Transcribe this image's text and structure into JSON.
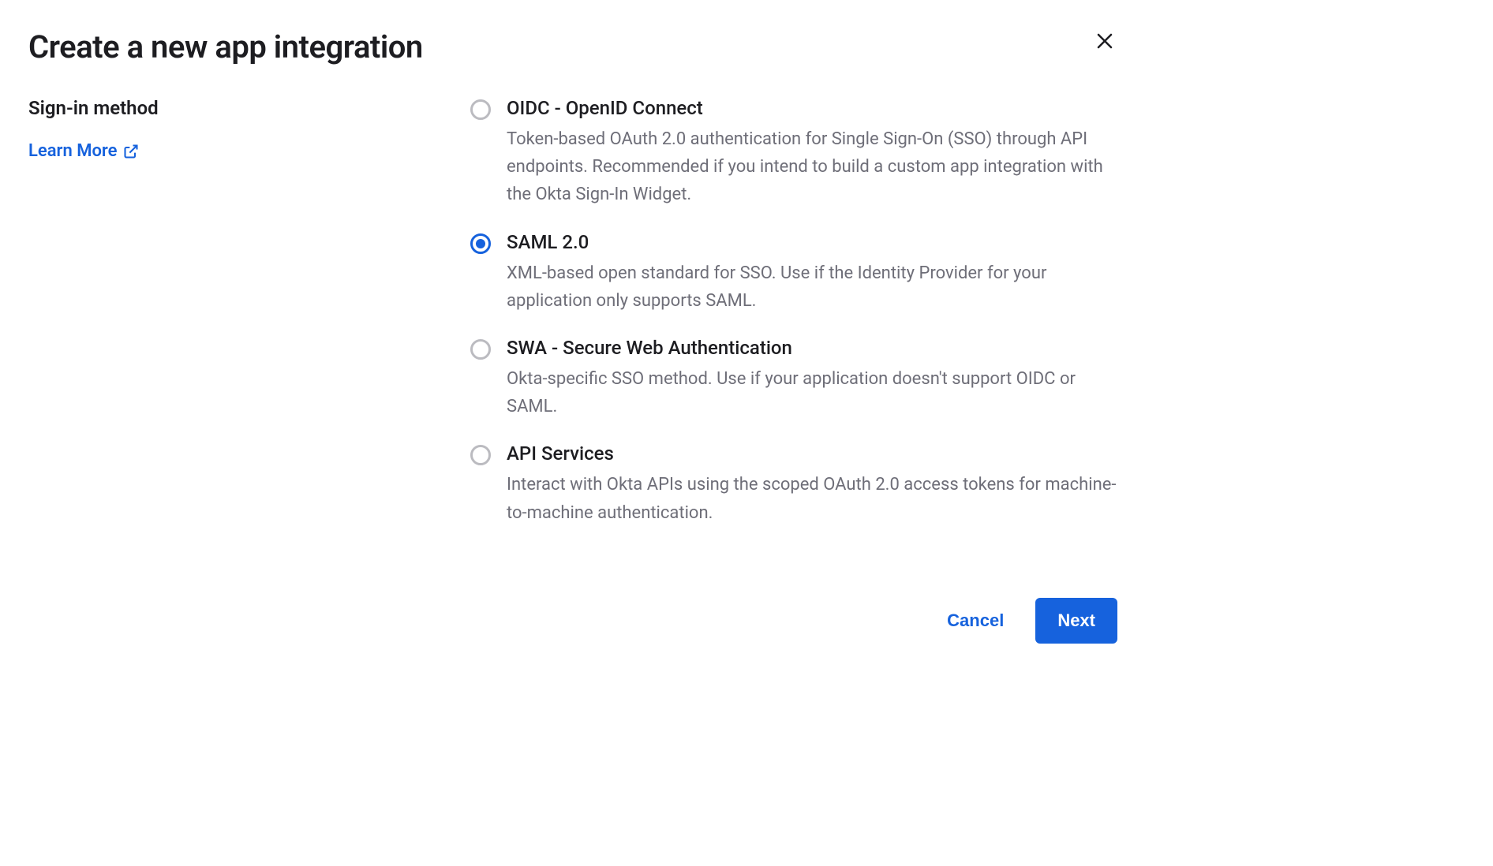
{
  "title": "Create a new app integration",
  "sectionLabel": "Sign-in method",
  "learnMore": "Learn More",
  "options": [
    {
      "title": "OIDC - OpenID Connect",
      "desc": "Token-based OAuth 2.0 authentication for Single Sign-On (SSO) through API endpoints. Recommended if you intend to build a custom app integration with the Okta Sign-In Widget.",
      "selected": false
    },
    {
      "title": "SAML 2.0",
      "desc": "XML-based open standard for SSO. Use if the Identity Provider for your application only supports SAML.",
      "selected": true
    },
    {
      "title": "SWA - Secure Web Authentication",
      "desc": "Okta-specific SSO method. Use if your application doesn't support OIDC or SAML.",
      "selected": false
    },
    {
      "title": "API Services",
      "desc": "Interact with Okta APIs using the scoped OAuth 2.0 access tokens for machine-to-machine authentication.",
      "selected": false
    }
  ],
  "buttons": {
    "cancel": "Cancel",
    "next": "Next"
  }
}
